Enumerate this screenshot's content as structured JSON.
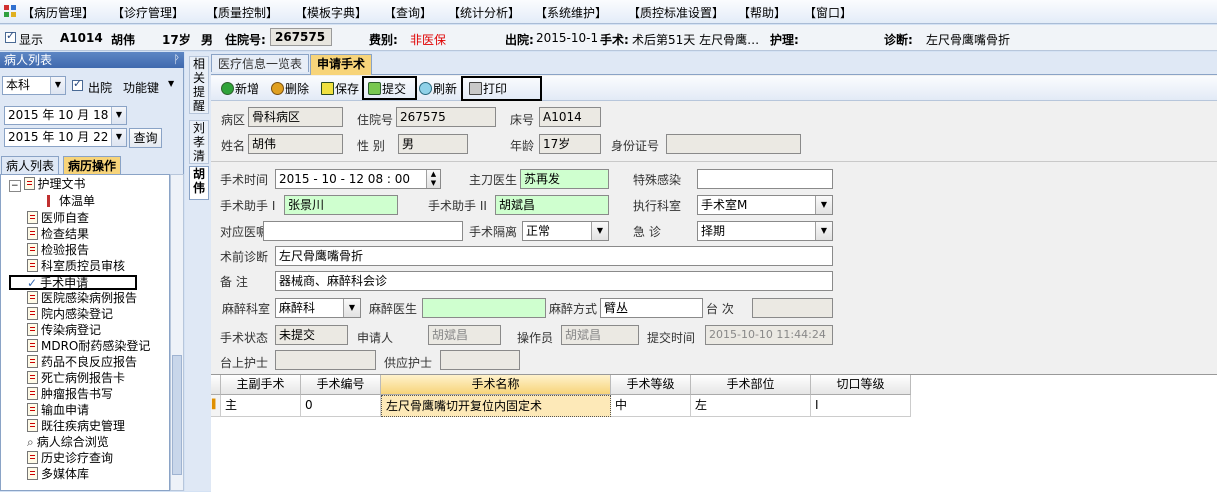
{
  "menubar": {
    "items": [
      "【病历管理】",
      "【诊疗管理】",
      "【质量控制】",
      "【模板字典】",
      "【查询】",
      "【统计分析】",
      "【系统维护】",
      "【质控标准设置】",
      "【帮助】",
      "【窗口】"
    ]
  },
  "patient": {
    "show_label": "显示",
    "bed": "A1014",
    "name": "胡伟",
    "age": "17岁",
    "sex": "男",
    "hosp_label": "住院号:",
    "hosp_no": "267575",
    "fee_label": "费别:",
    "fee": "非医保",
    "discharge_label": "出院:",
    "discharge": "2015-10-1",
    "surgery_label": "手术:",
    "surgery": "术后第51天 左尺骨鹰…",
    "nursing_label": "护理:",
    "diag_label": "诊断:",
    "diag": "左尺骨鹰嘴骨折"
  },
  "left": {
    "title": "病人列表",
    "dept": "本科",
    "discharged_label": "出院",
    "func_key": "功能键",
    "date1": "2015 年 10 月 18",
    "date2": "2015 年 10 月 22",
    "query": "查询",
    "tab_list": "病人列表",
    "tab_ops": "病历操作",
    "tree": [
      "护理文书",
      "体温单",
      "医师自查",
      "检查结果",
      "检验报告",
      "科室质控员审核",
      "手术申请",
      "医院感染病例报告",
      "院内感染登记",
      "传染病登记",
      "MDRO耐药感染登记",
      "药品不良反应报告",
      "死亡病例报告卡",
      "肿瘤报告书写",
      "输血申请",
      "既往疾病史管理",
      "病人综合浏览",
      "历史诊疗查询",
      "多媒体库"
    ]
  },
  "side_tabs": [
    "相关提醒",
    "刘孝清",
    "胡伟"
  ],
  "tabs": {
    "t1": "医疗信息一览表",
    "t2": "申请手术"
  },
  "toolbar": {
    "add": "新增",
    "del": "删除",
    "save": "保存",
    "submit": "提交",
    "refresh": "刷新",
    "print": "打印"
  },
  "form": {
    "ward_l": "病区",
    "ward": "骨科病区",
    "hosp_l": "住院号",
    "hosp": "267575",
    "bed_l": "床号",
    "bed": "A1014",
    "name_l": "姓名",
    "name": "胡伟",
    "sex_l": "性  别",
    "sex": "男",
    "age_l": "年龄",
    "age": "17岁",
    "id_l": "身份证号",
    "op_time_l": "手术时间",
    "op_time": "2015 - 10 - 12    08 : 00",
    "surgeon_l": "主刀医生",
    "surgeon": "苏再发",
    "infect_l": "特殊感染",
    "asst1_l": "手术助手 I",
    "asst1": "张景川",
    "asst2_l": "手术助手 II",
    "asst2": "胡斌昌",
    "exec_l": "执行科室",
    "exec": "手术室M",
    "order_l": "对应医嘱",
    "iso_l": "手术隔离",
    "iso": "正常",
    "urgent_l": "急    诊",
    "urgent": "择期",
    "pre_l": "术前诊断",
    "pre": "左尺骨鹰嘴骨折",
    "note_l": "备    注",
    "note": "器械商、麻醉科会诊",
    "anes_dept_l": "麻醉科室",
    "anes_dept": "麻醉科",
    "anes_doc_l": "麻醉医生",
    "anes_way_l": "麻醉方式",
    "anes_way": "臂丛",
    "seq_l": "台  次",
    "status_l": "手术状态",
    "status": "未提交",
    "applicant_l": "申请人",
    "applicant": "胡斌昌",
    "operator_l": "操作员",
    "operator": "胡斌昌",
    "submit_time_l": "提交时间",
    "submit_time": "2015-10-10 11:44:24",
    "nurse_l": "台上护士",
    "supply_l": "供应护士"
  },
  "grid": {
    "headers": [
      "主副手术",
      "手术编号",
      "手术名称",
      "手术等级",
      "手术部位",
      "切口等级"
    ],
    "row": [
      "主",
      "0",
      "左尺骨鹰嘴切开复位内固定术",
      "中",
      "左",
      "I"
    ]
  }
}
